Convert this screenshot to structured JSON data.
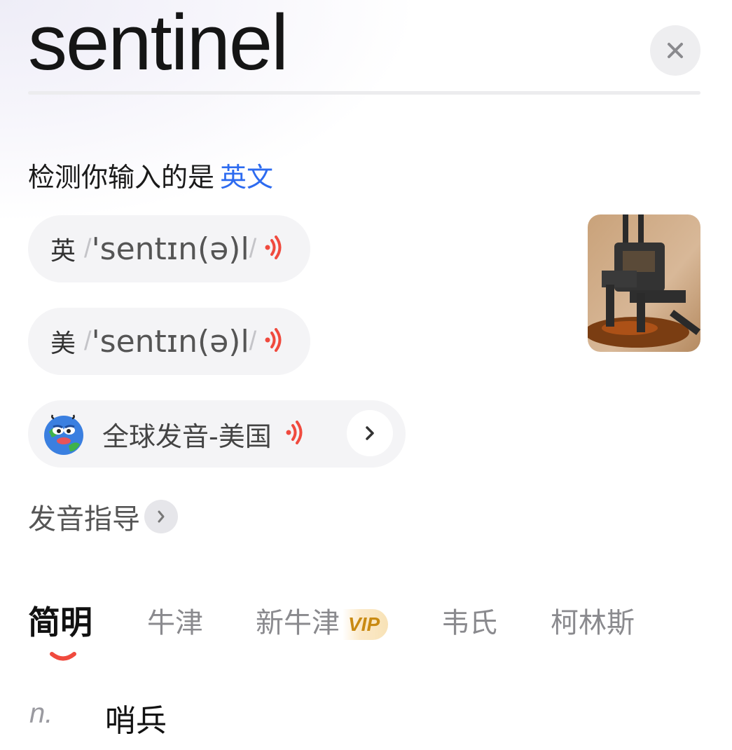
{
  "query": {
    "word": "sentinel"
  },
  "detect": {
    "prefix": "检测你输入的是",
    "language": "英文"
  },
  "pronunciations": [
    {
      "region": "英",
      "ipa": "'sentɪn(ə)l",
      "icon": "speaker-icon"
    },
    {
      "region": "美",
      "ipa": "'sentɪn(ə)l",
      "icon": "speaker-icon"
    }
  ],
  "global_pron": {
    "label": "全球发音-美国",
    "icon": "globe-avatar"
  },
  "guide": {
    "label": "发音指导"
  },
  "tabs": [
    {
      "label": "简明",
      "active": true
    },
    {
      "label": "牛津"
    },
    {
      "label": "新牛津",
      "badge": "VIP"
    },
    {
      "label": "韦氏"
    },
    {
      "label": "柯林斯"
    }
  ],
  "definitions": [
    {
      "pos": "n.",
      "meaning": "哨兵"
    }
  ],
  "colors": {
    "accent_blue": "#2d6bf0",
    "speaker_red": "#f04a3e",
    "vip_gold": "#c98a12"
  }
}
